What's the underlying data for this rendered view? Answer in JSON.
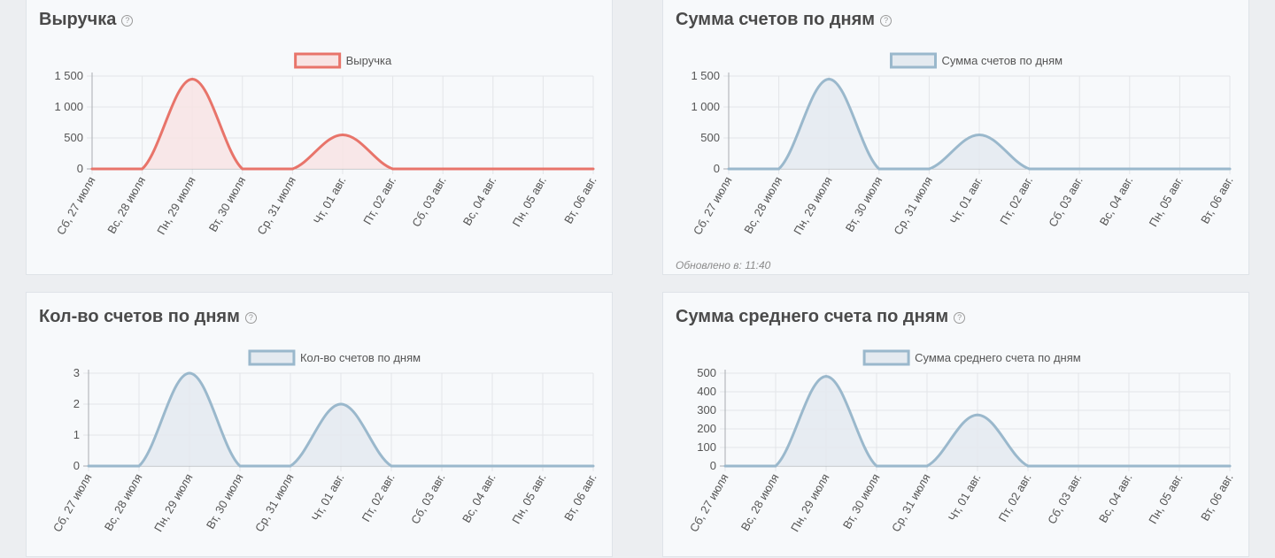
{
  "panels": [
    {
      "title": "Выручка",
      "help": "?",
      "updated": "",
      "chart_data": {
        "type": "area",
        "title": "Выручка",
        "categories": [
          "Сб, 27 июля",
          "Вс, 28 июля",
          "Пн, 29 июля",
          "Вт, 30 июля",
          "Ср, 31 июля",
          "Чт, 01 авг.",
          "Пт, 02 авг.",
          "Сб, 03 авг.",
          "Вс, 04 авг.",
          "Пн, 05 авг.",
          "Вт, 06 авг."
        ],
        "series": [
          {
            "name": "Выручка",
            "values": [
              0,
              0,
              1450,
              0,
              0,
              550,
              0,
              0,
              0,
              0,
              0
            ],
            "color": "#e8746a",
            "fill": "#f8e4e4"
          }
        ],
        "ylim": [
          0,
          1500
        ],
        "yticks": [
          0,
          500,
          1000,
          1500
        ],
        "ytick_labels": [
          "0",
          "500",
          "1 000",
          "1 500"
        ],
        "grid": true,
        "legend": "top-center"
      }
    },
    {
      "title": "Сумма счетов по дням",
      "help": "?",
      "updated": "Обновлено в: 11:40",
      "chart_data": {
        "type": "area",
        "title": "Сумма счетов по дням",
        "categories": [
          "Сб, 27 июля",
          "Вс, 28 июля",
          "Пн, 29 июля",
          "Вт, 30 июля",
          "Ср, 31 июля",
          "Чт, 01 авг.",
          "Пт, 02 авг.",
          "Сб, 03 авг.",
          "Вс, 04 авг.",
          "Пн, 05 авг.",
          "Вт, 06 авг."
        ],
        "series": [
          {
            "name": "Сумма счетов по дням",
            "values": [
              0,
              0,
              1450,
              0,
              0,
              550,
              0,
              0,
              0,
              0,
              0
            ],
            "color": "#9ab8cc",
            "fill": "#e4eaf0"
          }
        ],
        "ylim": [
          0,
          1500
        ],
        "yticks": [
          0,
          500,
          1000,
          1500
        ],
        "ytick_labels": [
          "0",
          "500",
          "1 000",
          "1 500"
        ],
        "grid": true,
        "legend": "top-center"
      }
    },
    {
      "title": "Кол-во счетов по дням",
      "help": "?",
      "updated": "",
      "chart_data": {
        "type": "area",
        "title": "Кол-во счетов по дням",
        "categories": [
          "Сб, 27 июля",
          "Вс, 28 июля",
          "Пн, 29 июля",
          "Вт, 30 июля",
          "Ср, 31 июля",
          "Чт, 01 авг.",
          "Пт, 02 авг.",
          "Сб, 03 авг.",
          "Вс, 04 авг.",
          "Пн, 05 авг.",
          "Вт, 06 авг."
        ],
        "series": [
          {
            "name": "Кол-во счетов по дням",
            "values": [
              0,
              0,
              3,
              0,
              0,
              2,
              0,
              0,
              0,
              0,
              0
            ],
            "color": "#9ab8cc",
            "fill": "#e4eaf0"
          }
        ],
        "ylim": [
          0,
          3
        ],
        "yticks": [
          0,
          1,
          2,
          3
        ],
        "ytick_labels": [
          "0",
          "1",
          "2",
          "3"
        ],
        "grid": true,
        "legend": "top-center"
      }
    },
    {
      "title": "Сумма среднего счета по дням",
      "help": "?",
      "updated": "",
      "chart_data": {
        "type": "area",
        "title": "Сумма среднего счета по дням",
        "categories": [
          "Сб, 27 июля",
          "Вс, 28 июля",
          "Пн, 29 июля",
          "Вт, 30 июля",
          "Ср, 31 июля",
          "Чт, 01 авг.",
          "Пт, 02 авг.",
          "Сб, 03 авг.",
          "Вс, 04 авг.",
          "Пн, 05 авг.",
          "Вт, 06 авг."
        ],
        "series": [
          {
            "name": "Сумма среднего счета по дням",
            "values": [
              0,
              0,
              483,
              0,
              0,
              275,
              0,
              0,
              0,
              0,
              0
            ],
            "color": "#9ab8cc",
            "fill": "#e4eaf0"
          }
        ],
        "ylim": [
          0,
          500
        ],
        "yticks": [
          0,
          100,
          200,
          300,
          400,
          500
        ],
        "ytick_labels": [
          "0",
          "100",
          "200",
          "300",
          "400",
          "500"
        ],
        "grid": true,
        "legend": "top-center"
      }
    }
  ]
}
